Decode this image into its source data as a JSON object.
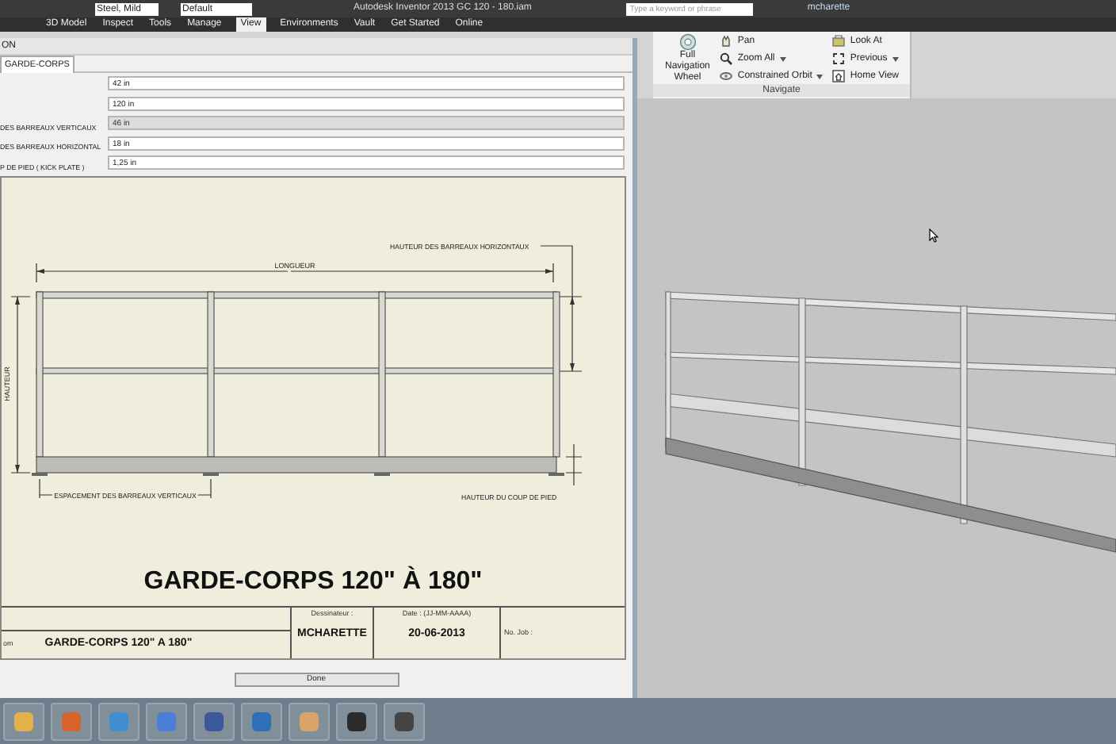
{
  "qat": {
    "material": "Steel, Mild",
    "appearance": "Default"
  },
  "title": "Autodesk Inventor 2013    GC 120 - 180.iam",
  "search": {
    "placeholder": "Type a keyword or phrase"
  },
  "user": "mcharette",
  "ribbon_tabs": [
    {
      "label": "3D Model",
      "selected": false
    },
    {
      "label": "Inspect",
      "selected": false
    },
    {
      "label": "Tools",
      "selected": false
    },
    {
      "label": "Manage",
      "selected": false
    },
    {
      "label": "View",
      "selected": true
    },
    {
      "label": "Environments",
      "selected": false
    },
    {
      "label": "Vault",
      "selected": false
    },
    {
      "label": "Get Started",
      "selected": false
    },
    {
      "label": "Online",
      "selected": false
    }
  ],
  "navigate_panel": {
    "wheel": "Full Navigation Wheel",
    "title": "Navigate",
    "tools": [
      {
        "label": "Pan",
        "kind": "pan",
        "dropdown": false
      },
      {
        "label": "Zoom All",
        "kind": "zoom",
        "dropdown": true
      },
      {
        "label": "Constrained Orbit",
        "kind": "orbit",
        "dropdown": true
      },
      {
        "label": "Look At",
        "kind": "lookat",
        "dropdown": false
      },
      {
        "label": "Previous",
        "kind": "previous",
        "dropdown": true
      },
      {
        "label": "Home View",
        "kind": "home",
        "dropdown": false
      }
    ]
  },
  "dialog": {
    "title": "ON",
    "tabs": [
      {
        "label": "GARDE-CORPS",
        "selected": true
      }
    ],
    "fields": [
      {
        "value": "42 in",
        "disabled": false
      },
      {
        "value": "120 in",
        "disabled": false
      },
      {
        "label": "DES BARREAUX VERTICAUX",
        "value": "46 in",
        "disabled": true
      },
      {
        "label": "DES BARREAUX HORIZONTAL",
        "value": "18 in",
        "disabled": false
      },
      {
        "label": "P DE PIED ( KICK PLATE )",
        "value": "1,25 in",
        "disabled": false
      }
    ],
    "drawing": {
      "length_label": "LONGUEUR",
      "height_label": "HAUTEUR",
      "rail_height_label": "HAUTEUR DES BARREAUX HORIZONTAUX",
      "spacing_label": "ESPACEMENT DES BARREAUX VERTICAUX",
      "kick_label": "HAUTEUR DU COUP DE PIED",
      "title": "GARDE-CORPS 120\" À 180\""
    },
    "title_block": {
      "name_label": "om",
      "name": "GARDE-CORPS 120\" A 180\"",
      "designer_label": "Dessinateur :",
      "designer": "MCHARETTE",
      "date_label": "Date : (JJ-MM-AAAA)",
      "date": "20-06-2013",
      "job_label": "No. Job :"
    },
    "done": "Done"
  }
}
